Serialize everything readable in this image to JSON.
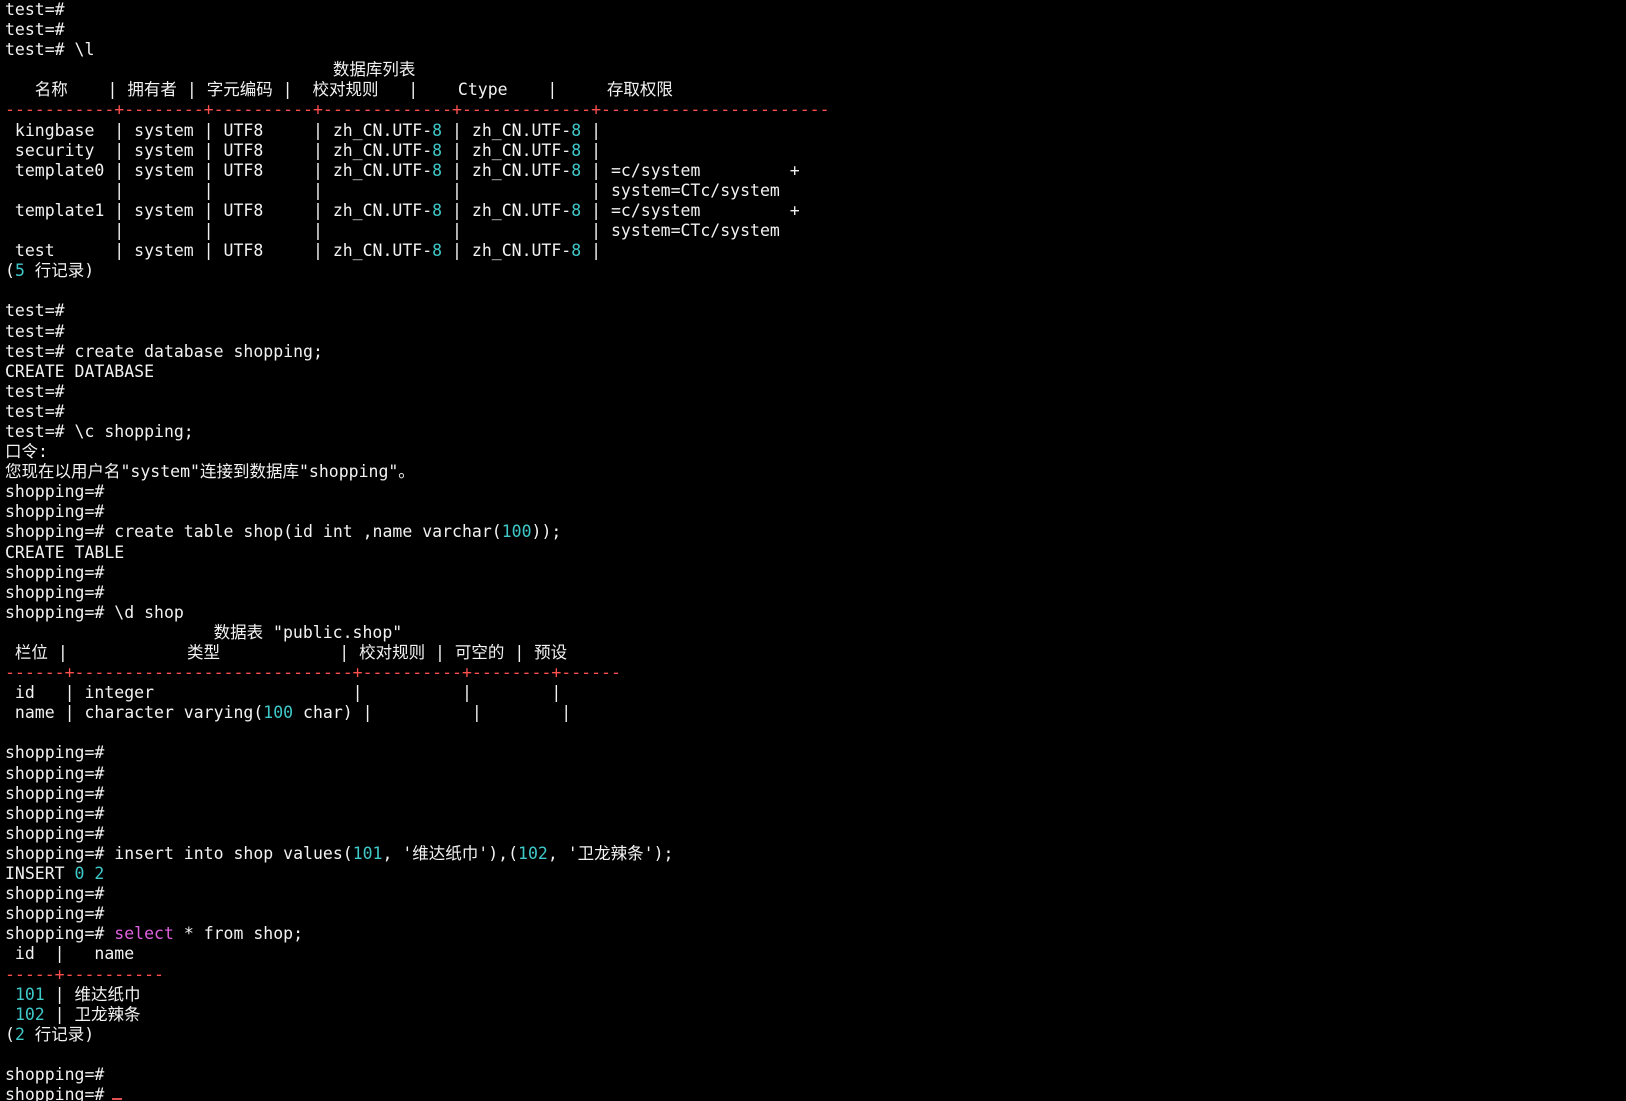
{
  "colors": {
    "background": "#000000",
    "text": "#f2f2f2",
    "number": "#3fc9c9",
    "red": "#ff4f4f",
    "keyword": "#e060e0",
    "cursor": "#e05050"
  },
  "lines": [
    {
      "segs": [
        {
          "t": "test=#"
        }
      ]
    },
    {
      "segs": [
        {
          "t": "test=#"
        }
      ]
    },
    {
      "segs": [
        {
          "t": "test=# \\l"
        }
      ]
    },
    {
      "segs": [
        {
          "t": "                                 数据库列表"
        }
      ]
    },
    {
      "segs": [
        {
          "t": "   名称    | 拥有者 | 字元编码 |  校对规则   |    Ctype    |     存取权限"
        }
      ]
    },
    {
      "segs": [
        {
          "t": "-----------+--------+----------+-------------+-------------+-----------------------",
          "c": "red"
        }
      ]
    },
    {
      "segs": [
        {
          "t": " kingbase  | system | UTF8     | zh_CN.UTF-"
        },
        {
          "t": "8",
          "c": "number"
        },
        {
          "t": " | zh_CN.UTF-"
        },
        {
          "t": "8",
          "c": "number"
        },
        {
          "t": " |"
        }
      ]
    },
    {
      "segs": [
        {
          "t": " security  | system | UTF8     | zh_CN.UTF-"
        },
        {
          "t": "8",
          "c": "number"
        },
        {
          "t": " | zh_CN.UTF-"
        },
        {
          "t": "8",
          "c": "number"
        },
        {
          "t": " |"
        }
      ]
    },
    {
      "segs": [
        {
          "t": " template0 | system | UTF8     | zh_CN.UTF-"
        },
        {
          "t": "8",
          "c": "number"
        },
        {
          "t": " | zh_CN.UTF-"
        },
        {
          "t": "8",
          "c": "number"
        },
        {
          "t": " | =c/system         +"
        }
      ]
    },
    {
      "segs": [
        {
          "t": "           |        |          |             |             | system=CTc/system"
        }
      ]
    },
    {
      "segs": [
        {
          "t": " template1 | system | UTF8     | zh_CN.UTF-"
        },
        {
          "t": "8",
          "c": "number"
        },
        {
          "t": " | zh_CN.UTF-"
        },
        {
          "t": "8",
          "c": "number"
        },
        {
          "t": " | =c/system         +"
        }
      ]
    },
    {
      "segs": [
        {
          "t": "           |        |          |             |             | system=CTc/system"
        }
      ]
    },
    {
      "segs": [
        {
          "t": " test      | system | UTF8     | zh_CN.UTF-"
        },
        {
          "t": "8",
          "c": "number"
        },
        {
          "t": " | zh_CN.UTF-"
        },
        {
          "t": "8",
          "c": "number"
        },
        {
          "t": " |"
        }
      ]
    },
    {
      "segs": [
        {
          "t": "("
        },
        {
          "t": "5",
          "c": "number"
        },
        {
          "t": " 行记录)"
        }
      ]
    },
    {
      "segs": [
        {
          "t": ""
        }
      ]
    },
    {
      "segs": [
        {
          "t": "test=#"
        }
      ]
    },
    {
      "segs": [
        {
          "t": "test=#"
        }
      ]
    },
    {
      "segs": [
        {
          "t": "test=# create database shopping;"
        }
      ]
    },
    {
      "segs": [
        {
          "t": "CREATE DATABASE"
        }
      ]
    },
    {
      "segs": [
        {
          "t": "test=#"
        }
      ]
    },
    {
      "segs": [
        {
          "t": "test=#"
        }
      ]
    },
    {
      "segs": [
        {
          "t": "test=# \\c shopping;"
        }
      ]
    },
    {
      "segs": [
        {
          "t": "口令:"
        }
      ]
    },
    {
      "segs": [
        {
          "t": "您现在以用户名\"system\"连接到数据库\"shopping\"。"
        }
      ]
    },
    {
      "segs": [
        {
          "t": "shopping=#"
        }
      ]
    },
    {
      "segs": [
        {
          "t": "shopping=#"
        }
      ]
    },
    {
      "segs": [
        {
          "t": "shopping=# create table shop(id int ,name varchar("
        },
        {
          "t": "100",
          "c": "number"
        },
        {
          "t": "));"
        }
      ]
    },
    {
      "segs": [
        {
          "t": "CREATE TABLE"
        }
      ]
    },
    {
      "segs": [
        {
          "t": "shopping=#"
        }
      ]
    },
    {
      "segs": [
        {
          "t": "shopping=#"
        }
      ]
    },
    {
      "segs": [
        {
          "t": "shopping=# \\d shop"
        }
      ]
    },
    {
      "segs": [
        {
          "t": "                     数据表 \"public.shop\""
        }
      ]
    },
    {
      "segs": [
        {
          "t": " 栏位 |            类型            | 校对规则 | 可空的 | 预设"
        }
      ]
    },
    {
      "segs": [
        {
          "t": "------+----------------------------+----------+--------+------",
          "c": "red"
        }
      ]
    },
    {
      "segs": [
        {
          "t": " id   | integer                    |          |        |"
        }
      ]
    },
    {
      "segs": [
        {
          "t": " name | character varying("
        },
        {
          "t": "100",
          "c": "number"
        },
        {
          "t": " char) |          |        |"
        }
      ]
    },
    {
      "segs": [
        {
          "t": ""
        }
      ]
    },
    {
      "segs": [
        {
          "t": "shopping=#"
        }
      ]
    },
    {
      "segs": [
        {
          "t": "shopping=#"
        }
      ]
    },
    {
      "segs": [
        {
          "t": "shopping=#"
        }
      ]
    },
    {
      "segs": [
        {
          "t": "shopping=#"
        }
      ]
    },
    {
      "segs": [
        {
          "t": "shopping=#"
        }
      ]
    },
    {
      "segs": [
        {
          "t": "shopping=# insert into shop values("
        },
        {
          "t": "101",
          "c": "number"
        },
        {
          "t": ", '维达纸巾'),("
        },
        {
          "t": "102",
          "c": "number"
        },
        {
          "t": ", '卫龙辣条');"
        }
      ]
    },
    {
      "segs": [
        {
          "t": "INSERT "
        },
        {
          "t": "0",
          "c": "number"
        },
        {
          "t": " "
        },
        {
          "t": "2",
          "c": "number"
        }
      ]
    },
    {
      "segs": [
        {
          "t": "shopping=#"
        }
      ]
    },
    {
      "segs": [
        {
          "t": "shopping=#"
        }
      ]
    },
    {
      "segs": [
        {
          "t": "shopping=# "
        },
        {
          "t": "select",
          "c": "keyword"
        },
        {
          "t": " * from shop;"
        }
      ]
    },
    {
      "segs": [
        {
          "t": " id  |   name"
        }
      ]
    },
    {
      "segs": [
        {
          "t": "-----+",
          "c": "red"
        },
        {
          "t": "----------",
          "c": "red"
        }
      ]
    },
    {
      "segs": [
        {
          "t": " "
        },
        {
          "t": "101",
          "c": "number"
        },
        {
          "t": " | 维达纸巾"
        }
      ]
    },
    {
      "segs": [
        {
          "t": " "
        },
        {
          "t": "102",
          "c": "number"
        },
        {
          "t": " | 卫龙辣条"
        }
      ]
    },
    {
      "segs": [
        {
          "t": "("
        },
        {
          "t": "2",
          "c": "number"
        },
        {
          "t": " 行记录)"
        }
      ]
    },
    {
      "segs": [
        {
          "t": ""
        }
      ]
    },
    {
      "segs": [
        {
          "t": "shopping=#"
        }
      ]
    },
    {
      "segs": [
        {
          "t": "shopping=#"
        }
      ],
      "cursor": true
    }
  ]
}
